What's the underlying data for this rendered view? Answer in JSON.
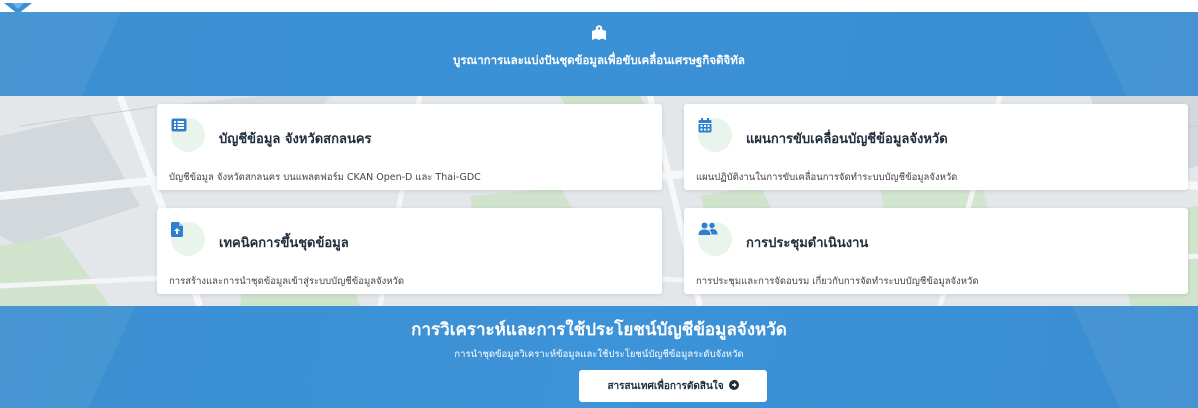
{
  "header": {
    "icon": "map-marked-icon",
    "title": "บูรณาการและแบ่งปันชุดข้อมูลเพื่อขับเคลื่อนเศรษฐกิจดิจิทัล"
  },
  "cards": [
    {
      "icon": "list-alt-icon",
      "title": "บัญชีข้อมูล จังหวัดสกลนคร",
      "description": "บัญชีข้อมูล จังหวัดสกลนคร บนแพลตฟอร์ม CKAN Open-D และ Thai-GDC"
    },
    {
      "icon": "calendar-icon",
      "title": "แผนการขับเคลื่อนบัญชีข้อมูลจังหวัด",
      "description": "แผนปฏิบัติงานในการขับเคลื่อนการจัดทำระบบบัญชีข้อมูลจังหวัด"
    },
    {
      "icon": "file-upload-icon",
      "title": "เทคนิคการขึ้นชุดข้อมูล",
      "description": "การสร้างและการนำชุดข้อมูลเข้าสู่ระบบบัญชีข้อมูลจังหวัด"
    },
    {
      "icon": "users-icon",
      "title": "การประชุมดำเนินงาน",
      "description": "การประชุมและการจัดอบรม เกี่ยวกับการจัดทำระบบบัญชีข้อมูลจังหวัด"
    }
  ],
  "analysis": {
    "title": "การวิเคราะห์และการใช้ประโยชน์บัญชีข้อมูลจังหวัด",
    "subtitle": "การนำชุดข้อมูลวิเคราะห์ข้อมูลและใช้ประโยชน์บัญชีข้อมูลระดับจังหวัด",
    "button_label": "สารสนเทศเพื่อการตัดสินใจ",
    "button_icon": "arrow-circle-right-icon"
  },
  "colors": {
    "band_blue": "#3b8fd4",
    "icon_blue": "#2f7fcf",
    "icon_bg": "#e9f4ec",
    "text_dark": "#1f2d3d"
  }
}
